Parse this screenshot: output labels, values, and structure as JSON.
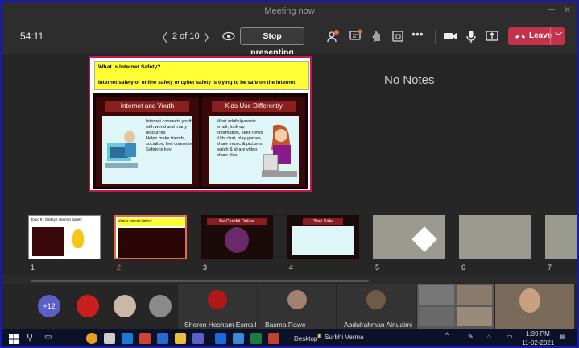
{
  "window": {
    "title": "Meeting now"
  },
  "toolbar": {
    "timer": "54:11",
    "page_count": "2 of 10",
    "stop_presenting": "Stop presenting",
    "reactions_badge": "",
    "leave": "Leave"
  },
  "slide": {
    "question": "What is Internet Safety?",
    "definition": "Internet safety or online safety or cyber safety  is trying to be safe on the internet",
    "left_title": "Internet and Youth",
    "left_bullets": [
      "Internet connects youths with world and many resources",
      "Helps make friends, socialize, feel connected",
      "Safety is key"
    ],
    "right_title": "Kids Use Differently",
    "right_bullets": [
      "Most adults/parents email, look up information, seek news",
      "Kids chat, play games, share music & pictures, watch & share video, share files"
    ]
  },
  "notes": {
    "text": "No Notes"
  },
  "thumbnails": [
    {
      "num": "1",
      "title": "Topic 9 : Safety / Internet Safety"
    },
    {
      "num": "2",
      "title": "What is Internet Safety?"
    },
    {
      "num": "3",
      "title": "Be Careful Online"
    },
    {
      "num": "4",
      "title": "Stay Safe"
    },
    {
      "num": "5",
      "title": ""
    },
    {
      "num": "6",
      "title": ""
    },
    {
      "num": "7",
      "title": ""
    }
  ],
  "participants": {
    "overflow": "+12",
    "tiles": [
      {
        "name": "Sheren Hesham Esmail"
      },
      {
        "name": "Basma Rawe"
      },
      {
        "name": "Abdulrahman Alnuaimi"
      }
    ]
  },
  "taskbar": {
    "desktop": "Desktop",
    "user": "Surbhi Verma",
    "time": "1:39 PM",
    "date": "11-02-2021"
  },
  "colors": {
    "accent": "#c4314b",
    "selected_thumb": "#e96b3c",
    "slide_border": "#c8164a"
  }
}
